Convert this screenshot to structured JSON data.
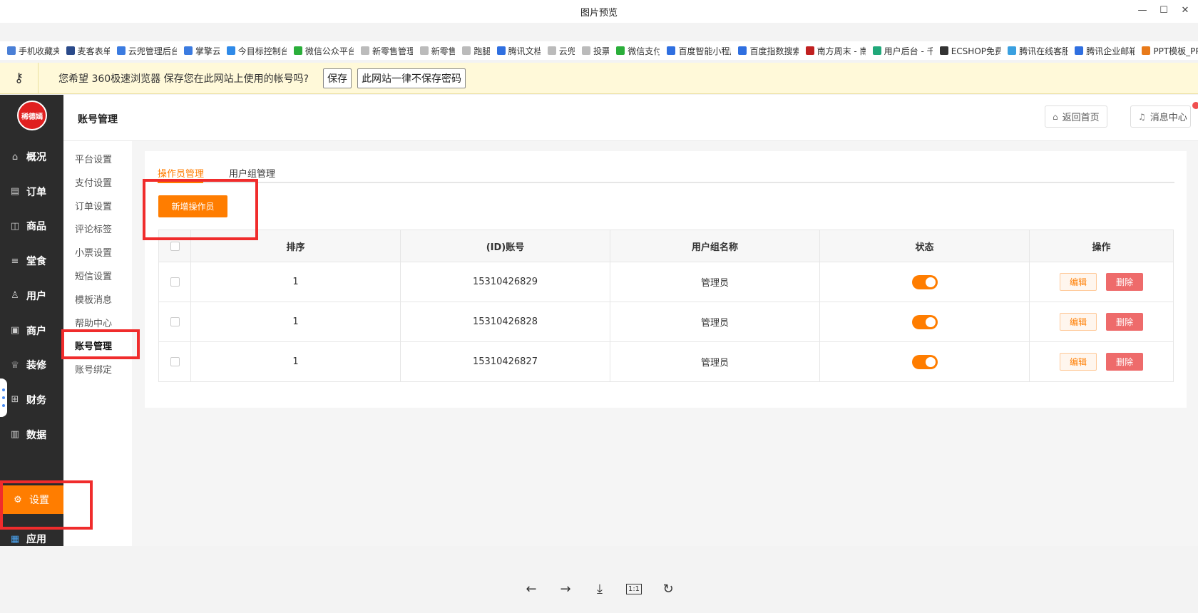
{
  "viewer": {
    "title": "图片预览",
    "minimize": "—",
    "maximize": "☐",
    "close": "✕",
    "toolbar": {
      "prev": "←",
      "next": "→",
      "download": "⤓",
      "actual_size": "1:1",
      "rotate": "↻"
    }
  },
  "bookmarks": [
    {
      "label": "手机收藏夹",
      "color": "#4a7fd6"
    },
    {
      "label": "麦客表单",
      "color": "#2a4a8a"
    },
    {
      "label": "云兜管理后台",
      "color": "#3b7be0"
    },
    {
      "label": "掌擎云",
      "color": "#3b7be0"
    },
    {
      "label": "今目标控制台",
      "color": "#2f8ae8"
    },
    {
      "label": "微信公众平台",
      "color": "#2aae3a"
    },
    {
      "label": "新零售管理",
      "color": "#bbbbbb"
    },
    {
      "label": "新零售",
      "color": "#bbbbbb"
    },
    {
      "label": "跑腿",
      "color": "#bbbbbb"
    },
    {
      "label": "腾讯文档",
      "color": "#2f6fe0"
    },
    {
      "label": "云兜",
      "color": "#bbbbbb"
    },
    {
      "label": "投票",
      "color": "#bbbbbb"
    },
    {
      "label": "微信支付",
      "color": "#2aae3a"
    },
    {
      "label": "百度智能小程序",
      "color": "#2f6fe0"
    },
    {
      "label": "百度指数搜索",
      "color": "#2f6fe0"
    },
    {
      "label": "南方周末 - 南",
      "color": "#c02020"
    },
    {
      "label": "用户后台 - 千",
      "color": "#21a87a"
    },
    {
      "label": "ECSHOP免费",
      "color": "#333333"
    },
    {
      "label": "腾讯在线客服",
      "color": "#3aa0e0"
    },
    {
      "label": "腾讯企业邮箱",
      "color": "#2f6fe0"
    },
    {
      "label": "PPT模板_PP",
      "color": "#e87a1a"
    }
  ],
  "password_bar": {
    "message": "您希望 360极速浏览器 保存您在此网站上使用的帐号吗?",
    "save_label": "保存",
    "never_label": "此网站一律不保存密码"
  },
  "app": {
    "logo_text": "稀德嫣",
    "page_title": "账号管理",
    "home_button": "返回首页",
    "message_button": "消息中心",
    "nav": [
      {
        "label": "概况",
        "icon": "⌂"
      },
      {
        "label": "订单",
        "icon": "▤"
      },
      {
        "label": "商品",
        "icon": "◫"
      },
      {
        "label": "堂食",
        "icon": "≡"
      },
      {
        "label": "用户",
        "icon": "♙"
      },
      {
        "label": "商户",
        "icon": "▣"
      },
      {
        "label": "装修",
        "icon": "♕"
      },
      {
        "label": "财务",
        "icon": "⊞"
      },
      {
        "label": "数据",
        "icon": "▥"
      }
    ],
    "nav_settings": "设置",
    "nav_apps": "应用",
    "subnav": [
      "平台设置",
      "支付设置",
      "订单设置",
      "评论标签",
      "小票设置",
      "短信设置",
      "模板消息",
      "帮助中心",
      "账号管理",
      "账号绑定"
    ],
    "tabs": [
      "操作员管理",
      "用户组管理"
    ],
    "add_button": "新增操作员",
    "table": {
      "headers": [
        "排序",
        "(ID)账号",
        "用户组名称",
        "状态",
        "操作"
      ],
      "rows": [
        {
          "order": "1",
          "account": "15310426829",
          "group": "管理员",
          "enabled": true
        },
        {
          "order": "1",
          "account": "15310426828",
          "group": "管理员",
          "enabled": true
        },
        {
          "order": "1",
          "account": "15310426827",
          "group": "管理员",
          "enabled": true
        }
      ],
      "edit_label": "编辑",
      "delete_label": "删除"
    }
  }
}
